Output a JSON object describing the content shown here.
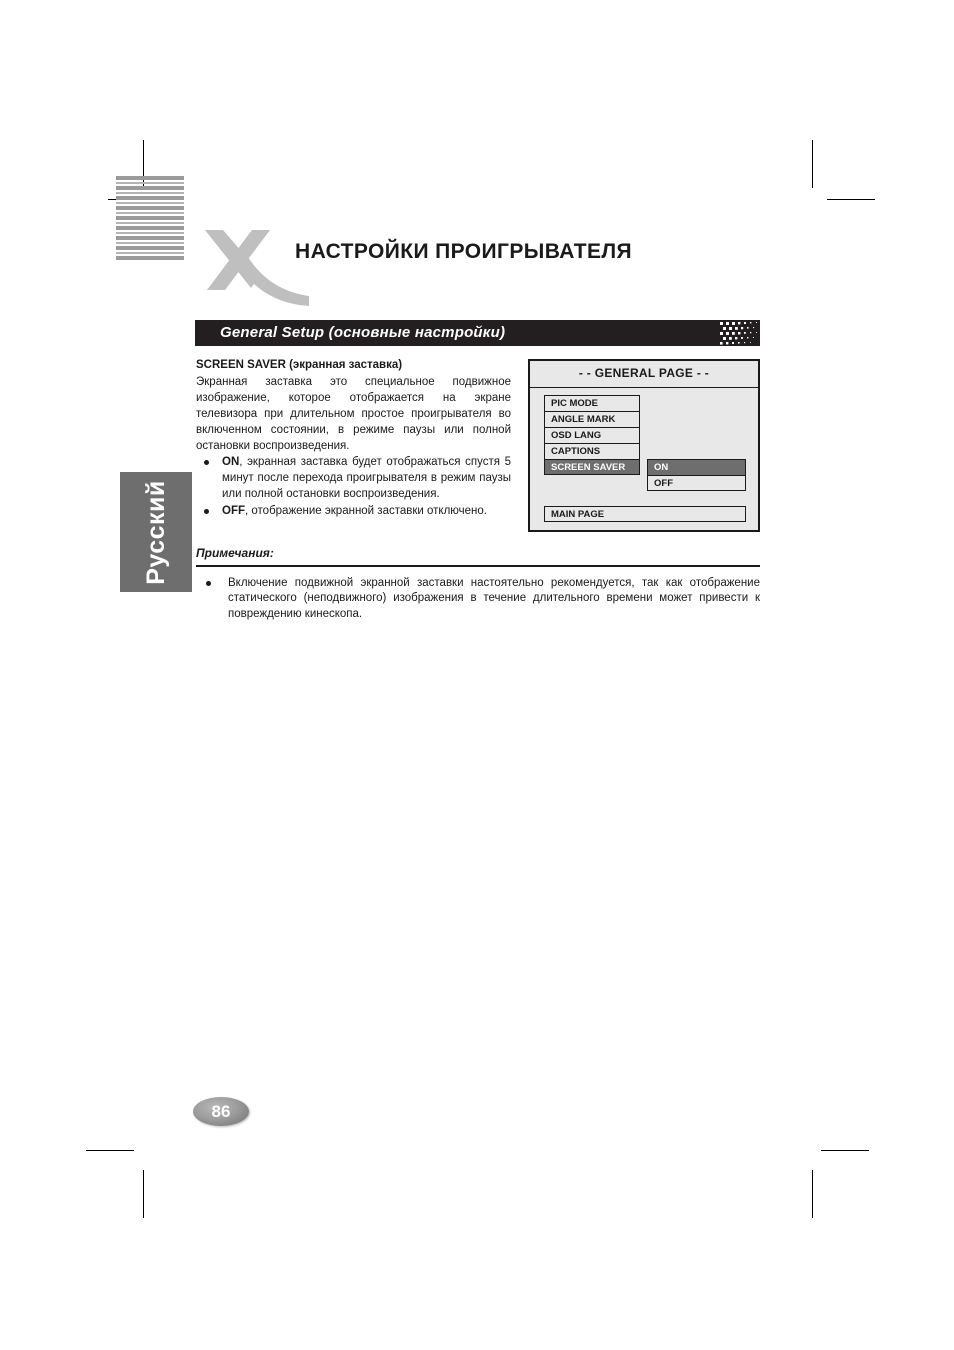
{
  "document": {
    "language_tab": "Русский",
    "page_number": "86",
    "title": "НАСТРОЙКИ ПРОИГРЫВАТЕЛЯ",
    "logo": "x-logo"
  },
  "section": {
    "title": "General Setup (основные настройки)"
  },
  "content": {
    "subhead_bold": "SCREEN SAVER",
    "subhead_rest": " (экранная заставка)",
    "paragraph": "Экранная заставка   это специальное подвижное изображение, которое отображается на экране телевизора при длительном простое проигрывателя во включенном состоянии, в режиме паузы или полной остановки воспроизведения.",
    "bullets": [
      {
        "lead": "ON",
        "text": ", экранная заставка будет отображаться спустя 5 минут после перехода проигрывателя в режим паузы или полной остановки воспроизведения."
      },
      {
        "lead": "OFF",
        "text": ", отображение экранной заставки отключено."
      }
    ]
  },
  "osd": {
    "title": "- - GENERAL PAGE - -",
    "menu_items": [
      {
        "label": "PIC MODE",
        "selected": false
      },
      {
        "label": "ANGLE MARK",
        "selected": false
      },
      {
        "label": "OSD LANG",
        "selected": false
      },
      {
        "label": "CAPTIONS",
        "selected": false
      },
      {
        "label": "SCREEN SAVER",
        "selected": true
      }
    ],
    "options": [
      {
        "label": "ON",
        "selected": true
      },
      {
        "label": "OFF",
        "selected": false
      }
    ],
    "main_page": "MAIN PAGE",
    "colors": {
      "background": "#e8e8e8",
      "border": "#1a1a1a",
      "highlight": "#6e6e6e",
      "highlight_text": "#ffffff"
    }
  },
  "notes": {
    "heading": "Примечания:",
    "items": [
      "Включение подвижной экранной заставки настоятельно рекомендуется, так как отображение статического (неподвижного) изображения в течение длительного времени может привести к повреждению кинескопа."
    ]
  },
  "colors": {
    "section_bar": "#231f20",
    "logo_gray": "#bfbfbf",
    "tab_gray": "#6e6e6e",
    "text": "#1a1a1a"
  }
}
